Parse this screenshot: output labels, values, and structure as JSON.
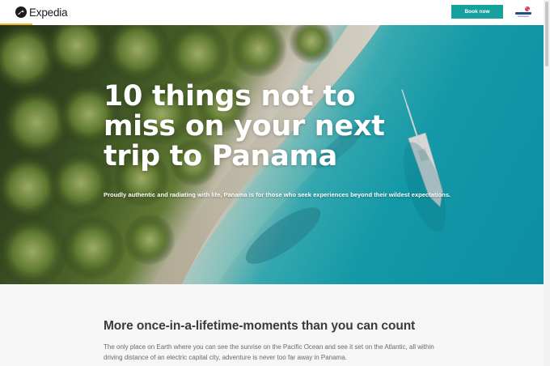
{
  "header": {
    "logo_text": "Expedia",
    "book_label": "Book now",
    "partner_logo_alt": "Panama",
    "accent_color": "#16a19e",
    "highlight_color": "#f3b51c"
  },
  "hero": {
    "title": "10 things not to miss on your next trip to Panama",
    "subtitle": "Proudly authentic and radiating with life, Panama is for those who seek experiences beyond their wildest expectations."
  },
  "intro": {
    "heading": "More once-in-a-lifetime-moments than you can count",
    "body": "The only place on Earth where you can see the sunrise on the Pacific Ocean and see it set on the Atlantic, all within driving distance of an electric capital city, adventure is never too far away in Panama."
  },
  "icons": {
    "logo": "expedia-plane-icon",
    "partner": "panama-logo-icon"
  }
}
